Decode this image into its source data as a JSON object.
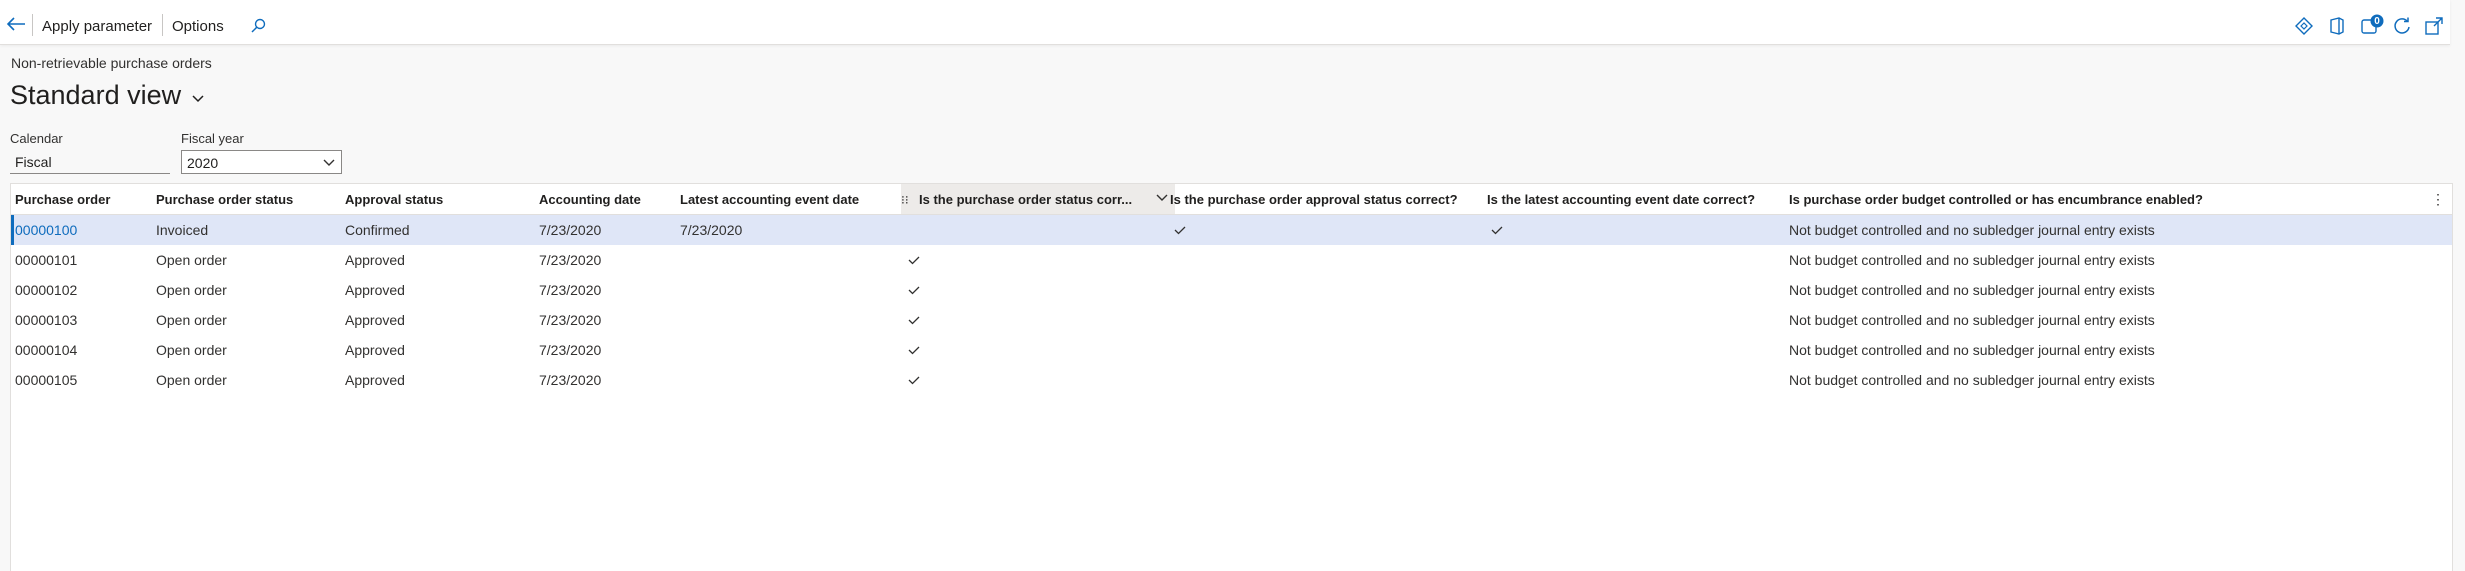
{
  "toolbar": {
    "back_icon": "arrow-left-icon",
    "apply_parameter_label": "Apply parameter",
    "options_label": "Options",
    "search_icon": "search-icon",
    "right_icons": [
      "diamond-icon",
      "office-icon",
      "notifications-icon",
      "refresh-icon",
      "open-in-new-window-icon"
    ],
    "notification_count": "0"
  },
  "page": {
    "caption": "Non-retrievable purchase orders",
    "view_title": "Standard view"
  },
  "filters": {
    "calendar_label": "Calendar",
    "calendar_value": "Fiscal",
    "fiscal_year_label": "Fiscal year",
    "fiscal_year_value": "2020"
  },
  "grid": {
    "columns": [
      "Purchase order",
      "Purchase order status",
      "Approval status",
      "Accounting date",
      "Latest accounting event date",
      "Is the purchase order status corr...",
      "Is the purchase order approval status correct?",
      "Is the latest accounting event date correct?",
      "Is purchase order budget controlled or has encumbrance enabled?"
    ],
    "rows": [
      {
        "po": "00000100",
        "status": "Invoiced",
        "approval": "Confirmed",
        "acct_date": "7/23/2020",
        "latest_date": "7/23/2020",
        "status_ok": false,
        "approval_ok": true,
        "event_ok": true,
        "budget": "Not budget controlled and no subledger journal entry exists",
        "selected": true
      },
      {
        "po": "00000101",
        "status": "Open order",
        "approval": "Approved",
        "acct_date": "7/23/2020",
        "latest_date": "",
        "status_ok": true,
        "approval_ok": false,
        "event_ok": false,
        "budget": "Not budget controlled and no subledger journal entry exists",
        "selected": false
      },
      {
        "po": "00000102",
        "status": "Open order",
        "approval": "Approved",
        "acct_date": "7/23/2020",
        "latest_date": "",
        "status_ok": true,
        "approval_ok": false,
        "event_ok": false,
        "budget": "Not budget controlled and no subledger journal entry exists",
        "selected": false
      },
      {
        "po": "00000103",
        "status": "Open order",
        "approval": "Approved",
        "acct_date": "7/23/2020",
        "latest_date": "",
        "status_ok": true,
        "approval_ok": false,
        "event_ok": false,
        "budget": "Not budget controlled and no subledger journal entry exists",
        "selected": false
      },
      {
        "po": "00000104",
        "status": "Open order",
        "approval": "Approved",
        "acct_date": "7/23/2020",
        "latest_date": "",
        "status_ok": true,
        "approval_ok": false,
        "event_ok": false,
        "budget": "Not budget controlled and no subledger journal entry exists",
        "selected": false
      },
      {
        "po": "00000105",
        "status": "Open order",
        "approval": "Approved",
        "acct_date": "7/23/2020",
        "latest_date": "",
        "status_ok": true,
        "approval_ok": false,
        "event_ok": false,
        "budget": "Not budget controlled and no subledger journal entry exists",
        "selected": false
      }
    ]
  },
  "colors": {
    "accent": "#0f6cbd",
    "selected_row": "#dfe6f7",
    "selected_border": "#0f6cbd"
  }
}
